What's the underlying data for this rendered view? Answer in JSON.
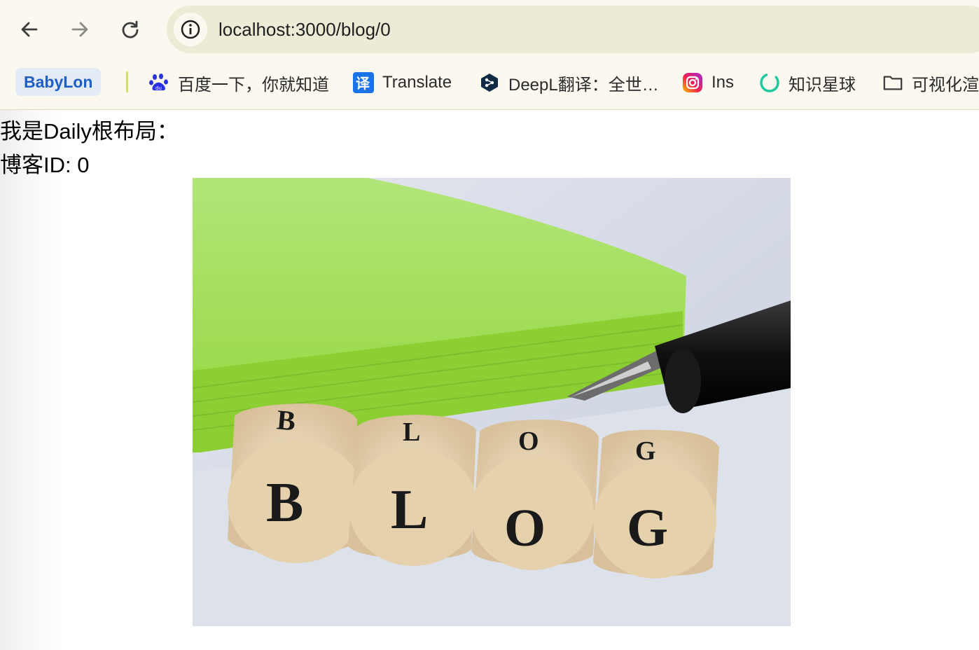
{
  "browser": {
    "url": "localhost:3000/blog/0",
    "nav": {
      "back_icon": "arrow-left-icon",
      "forward_icon": "arrow-right-icon",
      "reload_icon": "reload-icon",
      "site_info_icon": "info-icon"
    },
    "bookmarks": [
      {
        "label": "BabyLon",
        "icon": "none"
      },
      {
        "label": "百度一下，你就知道",
        "icon": "baidu-paw-icon"
      },
      {
        "label": "Translate",
        "icon": "translate-icon"
      },
      {
        "label": "DeepL翻译：全世…",
        "icon": "deepl-icon"
      },
      {
        "label": "Ins",
        "icon": "instagram-icon"
      },
      {
        "label": "知识星球",
        "icon": "zsxq-ring-icon"
      },
      {
        "label": "可视化渲",
        "icon": "folder-icon"
      }
    ]
  },
  "page": {
    "heading": "我是Daily根布局：",
    "blog_id_text": "博客ID: 0",
    "image": {
      "description_icon": "blog-dice-photo",
      "letters": [
        "B",
        "L",
        "O",
        "G"
      ]
    }
  },
  "colors": {
    "chrome_bg": "#fbf9ef",
    "omnibox_bg": "#ecebd6",
    "babylon_text": "#1f5fc4",
    "notebook_green": "#9fdc52"
  }
}
